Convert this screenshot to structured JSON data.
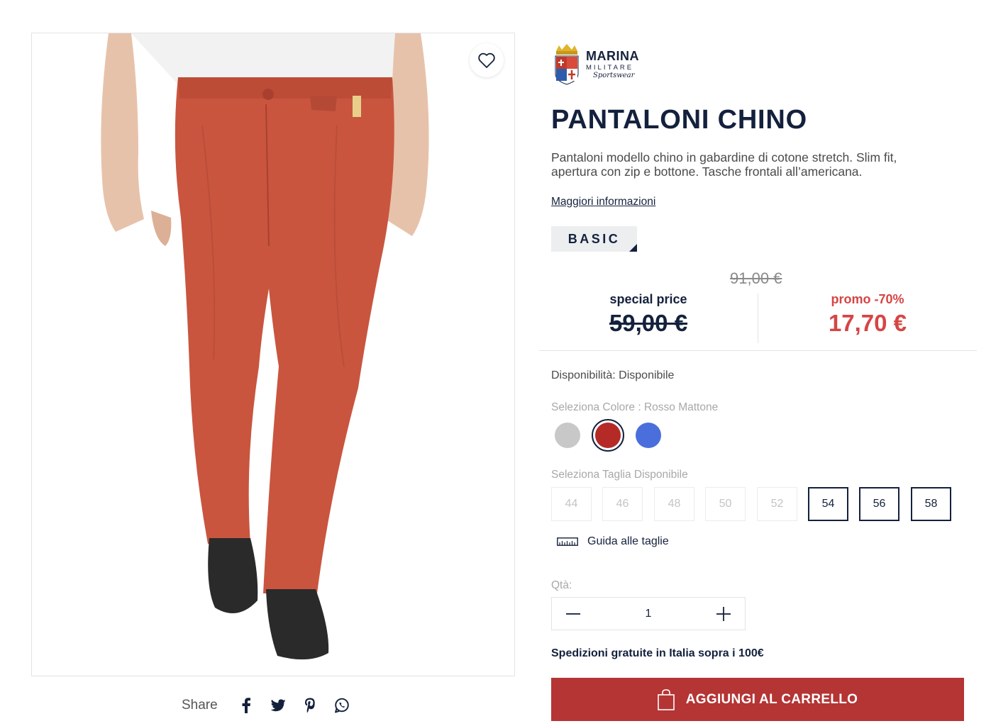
{
  "product": {
    "brand": {
      "line1": "MARINA",
      "line2": "MILITARE",
      "line3": "Sportswear"
    },
    "title": "PANTALONI CHINO",
    "description": "Pantaloni modello chino in gabardine di cotone stretch. Slim fit, apertura con zip e bottone. Tasche frontali all’americana.",
    "more_info": "Maggiori informazioni",
    "badge": "BASIC",
    "image_alt": "Pantaloni chino rosso mattone"
  },
  "pricing": {
    "original": "91,00 €",
    "special_label": "special price",
    "special_value": "59,00 €",
    "promo_label": "promo -70%",
    "promo_value": "17,70 €"
  },
  "availability": "Disponibilità: Disponibile",
  "color": {
    "label": "Seleziona Colore : Rosso Mattone",
    "swatches": [
      {
        "name": "grey",
        "hex": "#c8c8c8"
      },
      {
        "name": "rosso-mattone",
        "hex": "#b52a26",
        "selected": true
      },
      {
        "name": "blue",
        "hex": "#4a6fdc"
      }
    ]
  },
  "sizes": {
    "label": "Seleziona Taglia Disponibile",
    "options": [
      {
        "value": "44",
        "available": false
      },
      {
        "value": "46",
        "available": false
      },
      {
        "value": "48",
        "available": false
      },
      {
        "value": "50",
        "available": false
      },
      {
        "value": "52",
        "available": false
      },
      {
        "value": "54",
        "available": true
      },
      {
        "value": "56",
        "available": true
      },
      {
        "value": "58",
        "available": true
      }
    ],
    "guide": "Guida alle taglie"
  },
  "quantity": {
    "label": "Qtà:",
    "value": "1"
  },
  "shipping_note": "Spedizioni gratuite in Italia sopra i 100€",
  "cart_button": "AGGIUNGI AL CARRELLO",
  "share": {
    "label": "Share",
    "icons": [
      "facebook-icon",
      "twitter-icon",
      "pinterest-icon",
      "whatsapp-icon"
    ]
  },
  "colors": {
    "navy": "#14213d",
    "promo_red": "#d64545",
    "cart_red": "#b53434",
    "product_red": "#c9553f"
  }
}
